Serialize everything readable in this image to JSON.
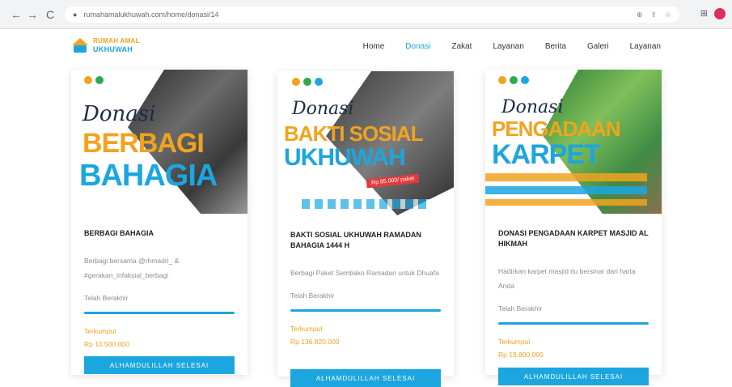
{
  "browser": {
    "url": "rumahamalukhuwah.com/home/donasi/14",
    "back": "←",
    "forward": "→",
    "reload": "C"
  },
  "header": {
    "logo_line1": "RUMAH AMAL",
    "logo_line2": "UKHUWAH",
    "nav": [
      "Home",
      "Donasi",
      "Zakat",
      "Layanan",
      "Berita",
      "Galeri",
      "Layanan"
    ],
    "active_index": 1
  },
  "cards": [
    {
      "poster": {
        "script": "Donasi",
        "line1": "BERBAGI",
        "line2": "BAHAGIA"
      },
      "title": "BERBAGI BAHAGIA",
      "desc": "Berbagi bersama @rhmadri_ & #gerakan_infaksial_berbagi",
      "raised_label": "Telah Berakhir",
      "progress": 1.0,
      "collected_label": "Terkumpul",
      "collected_value": "Rp 10.500.000",
      "button": "ALHAMDULILLAH SELESAI"
    },
    {
      "poster": {
        "script": "Donasi",
        "line1": "BAKTI SOSIAL",
        "line2": "UKHUWAH",
        "price": "Rp 85.000/ paket"
      },
      "title": "BAKTI SOSIAL UKHUWAH RAMADAN BAHAGIA 1444 H",
      "desc": "Berbagi Paket Sembako Ramadan untuk Dhuafa",
      "raised_label": "Telah Berakhir",
      "progress": 1.0,
      "collected_label": "Terkumpul",
      "collected_value": "Rp 136.820.000",
      "button": "ALHAMDULILLAH SELESAI"
    },
    {
      "poster": {
        "script": "Donasi",
        "line1": "PENGADAAN",
        "line2": "KARPET"
      },
      "title": "DONASI PENGADAAN KARPET MASJID AL HIKMAH",
      "desc": "Hadirkan karpet masjid itu bersinar dari harta Anda",
      "raised_label": "Telah Berakhir",
      "progress": 1.0,
      "collected_label": "Terkumpul",
      "collected_value": "Rp 19.800.000",
      "button": "ALHAMDULILLAH SELESAI"
    }
  ],
  "colors": {
    "accent": "#1ca6df",
    "orange": "#f2a31d"
  }
}
